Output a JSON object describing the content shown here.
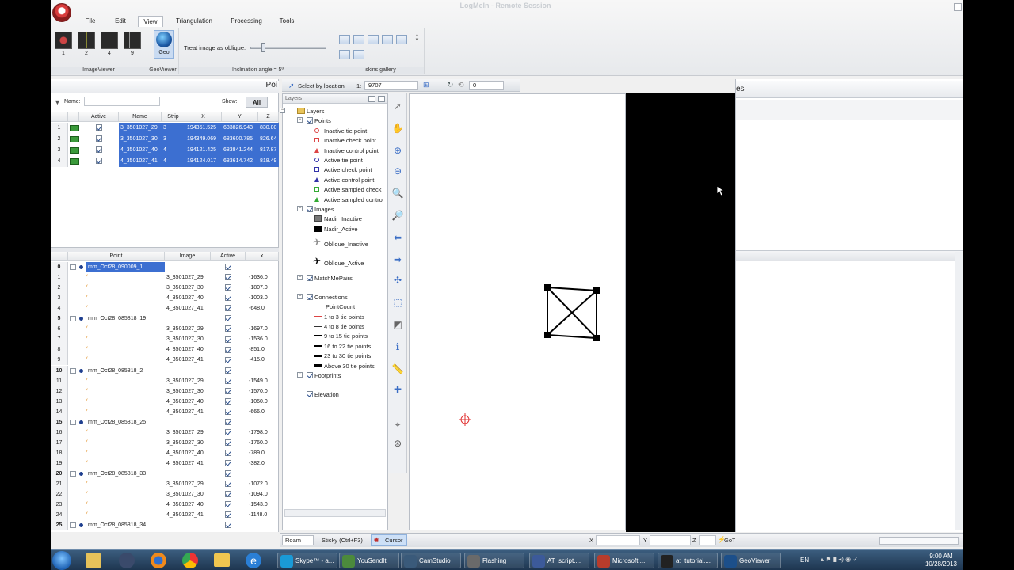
{
  "window": {
    "overlay_title": "LogMeIn - Remote Session"
  },
  "ribbon": {
    "tabs": [
      "File",
      "Edit",
      "View",
      "Triangulation",
      "Processing",
      "Tools"
    ],
    "selected_tab": "View",
    "imageviewer": {
      "buttons": [
        "1",
        "2",
        "4",
        "9"
      ],
      "label": "ImageViewer"
    },
    "geoviewer": {
      "button": "Geo",
      "label": "GeoViewer"
    },
    "oblique": {
      "text": "Treat image as oblique:",
      "label": "Inclination angle = 5º"
    },
    "skins": {
      "label": "skins gallery"
    }
  },
  "left": {
    "panel_title": "Poi",
    "filter_name_label": "Name:",
    "filter_show_label": "Show:",
    "filter_show_value": "All",
    "image_headers": [
      "Active",
      "Name",
      "Strip",
      "X",
      "Y",
      "Z"
    ],
    "images": [
      {
        "n": "1",
        "name": "3_3501027_29",
        "strip": "3",
        "x": "194351.525",
        "y": "683826.943",
        "z": "830.80"
      },
      {
        "n": "2",
        "name": "3_3501027_30",
        "strip": "3",
        "x": "194349.069",
        "y": "683600.785",
        "z": "826.64"
      },
      {
        "n": "3",
        "name": "4_3501027_40",
        "strip": "4",
        "x": "194121.425",
        "y": "683841.244",
        "z": "817.87"
      },
      {
        "n": "4",
        "name": "4_3501027_41",
        "strip": "4",
        "x": "194124.017",
        "y": "683614.742",
        "z": "818.49"
      }
    ],
    "point_headers": [
      "Point",
      "Image",
      "Active",
      "x"
    ],
    "points": [
      {
        "n": "0",
        "point": "mm_Oct28_090009_1",
        "image": "",
        "x": "",
        "group": true,
        "sel": true
      },
      {
        "n": "1",
        "point": "",
        "image": "3_3501027_29",
        "x": "-1636.0"
      },
      {
        "n": "2",
        "point": "",
        "image": "3_3501027_30",
        "x": "-1807.0"
      },
      {
        "n": "3",
        "point": "",
        "image": "4_3501027_40",
        "x": "-1003.0"
      },
      {
        "n": "4",
        "point": "",
        "image": "4_3501027_41",
        "x": "-648.0"
      },
      {
        "n": "5",
        "point": "mm_Oct28_085818_19",
        "image": "",
        "x": "",
        "group": true
      },
      {
        "n": "6",
        "point": "",
        "image": "3_3501027_29",
        "x": "-1697.0"
      },
      {
        "n": "7",
        "point": "",
        "image": "3_3501027_30",
        "x": "-1536.0"
      },
      {
        "n": "8",
        "point": "",
        "image": "4_3501027_40",
        "x": "-851.0"
      },
      {
        "n": "9",
        "point": "",
        "image": "4_3501027_41",
        "x": "-415.0"
      },
      {
        "n": "10",
        "point": "mm_Oct28_085818_2",
        "image": "",
        "x": "",
        "group": true
      },
      {
        "n": "11",
        "point": "",
        "image": "3_3501027_29",
        "x": "-1549.0"
      },
      {
        "n": "12",
        "point": "",
        "image": "3_3501027_30",
        "x": "-1570.0"
      },
      {
        "n": "13",
        "point": "",
        "image": "4_3501027_40",
        "x": "-1060.0"
      },
      {
        "n": "14",
        "point": "",
        "image": "4_3501027_41",
        "x": "-666.0"
      },
      {
        "n": "15",
        "point": "mm_Oct28_085818_25",
        "image": "",
        "x": "",
        "group": true
      },
      {
        "n": "16",
        "point": "",
        "image": "3_3501027_29",
        "x": "-1798.0"
      },
      {
        "n": "17",
        "point": "",
        "image": "3_3501027_30",
        "x": "-1760.0"
      },
      {
        "n": "18",
        "point": "",
        "image": "4_3501027_40",
        "x": "-789.0"
      },
      {
        "n": "19",
        "point": "",
        "image": "4_3501027_41",
        "x": "-382.0"
      },
      {
        "n": "20",
        "point": "mm_Oct28_085818_33",
        "image": "",
        "x": "",
        "group": true
      },
      {
        "n": "21",
        "point": "",
        "image": "3_3501027_29",
        "x": "-1072.0"
      },
      {
        "n": "22",
        "point": "",
        "image": "3_3501027_30",
        "x": "-1094.0"
      },
      {
        "n": "23",
        "point": "",
        "image": "4_3501027_40",
        "x": "-1543.0"
      },
      {
        "n": "24",
        "point": "",
        "image": "4_3501027_41",
        "x": "-1148.0"
      },
      {
        "n": "25",
        "point": "mm_Oct28_085818_34",
        "image": "",
        "x": "",
        "group": true
      }
    ]
  },
  "mid": {
    "select_by_location": "Select by location",
    "scale_prefix": "1:",
    "scale_value": "9707",
    "angle_value": "0",
    "layers_title": "Layers",
    "layers": {
      "root": "Layers",
      "points": "Points",
      "point_items": [
        "Inactive tie point",
        "Inactive check point",
        "Inactive control point",
        "Active tie point",
        "Active check point",
        "Active control point",
        "Active sampled check",
        "Active sampled contro"
      ],
      "images": "Images",
      "image_items": [
        "Nadir_Inactive",
        "Nadir_Active",
        "Oblique_Inactive",
        "Oblique_Active"
      ],
      "matchmepairs": "MatchMePairs",
      "connections": "Connections",
      "pointcount": "PointCount",
      "conn_items": [
        "1 to 3 tie points",
        "4 to 8 tie points",
        "9 to 15 tie points",
        "16 to 22 tie points",
        "23 to 30 tie points",
        "Above 30 tie points"
      ],
      "footprints": "Footprints",
      "elevation": "Elevation"
    }
  },
  "right": {
    "title": "es"
  },
  "status": {
    "roam": "Roam",
    "sticky": "Sticky (Ctrl+F3)",
    "cursor": "Cursor",
    "x_label": "X",
    "y_label": "Y",
    "z_label": "Z",
    "goto": "GoTo"
  },
  "taskbar": {
    "items": [
      "Skype™ - a...",
      "YouSendIt",
      "CamStudio",
      "Flashing",
      "AT_script....",
      "Microsoft ...",
      "at_tutorial....",
      "GeoViewer"
    ],
    "lang": "EN",
    "time": "9:00 AM",
    "date": "10/28/2013"
  },
  "colors": {
    "selection": "#3c6fd1",
    "accent": "#3b6ec5",
    "map_black": "#000000"
  }
}
